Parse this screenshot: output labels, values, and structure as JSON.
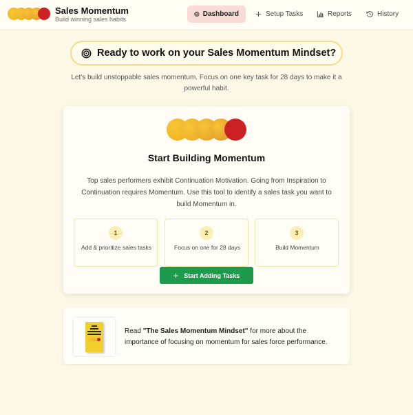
{
  "brand": {
    "title": "Sales Momentum",
    "subtitle": "Build winning sales habits",
    "dot_colors": [
      "#f2b21f",
      "#ecaa25",
      "#e49e2a",
      "#de902c",
      "#cc2122"
    ]
  },
  "nav": {
    "dashboard": "Dashboard",
    "setup_tasks": "Setup Tasks",
    "reports": "Reports",
    "history": "History"
  },
  "hero": {
    "title": "Ready to work on your Sales Momentum Mindset?",
    "intro": "Let's build unstoppable sales momentum. Focus on one key task for 28 days to make it a powerful habit."
  },
  "card": {
    "title": "Start Building Momentum",
    "description": "Top sales performers exhibit Continuation Motivation. Going from Inspiration to Continuation requires Momentum. Use this tool to identify a sales task you want to build Momentum in.",
    "steps": [
      {
        "number": "1",
        "label": "Add & prioritize sales tasks"
      },
      {
        "number": "2",
        "label": "Focus on one for 28 days"
      },
      {
        "number": "3",
        "label": "Build Momentum"
      }
    ],
    "start_button": "Start Adding Tasks"
  },
  "book": {
    "cover_lines": [
      "THE",
      "SALES",
      "MOMENTUM",
      "MINDSET"
    ],
    "text_prefix": "Read ",
    "book_title": "\"The Sales Momentum Mindset\"",
    "text_suffix": " for more about the importance of focusing on momentum for sales force performance."
  },
  "colors": {
    "accent_red": "#cc2122",
    "accent_yellow": "#f2b21f",
    "button_green": "#1d9a4c",
    "nav_active_bg": "#fadcd6",
    "page_bg": "#fdf9e6"
  }
}
